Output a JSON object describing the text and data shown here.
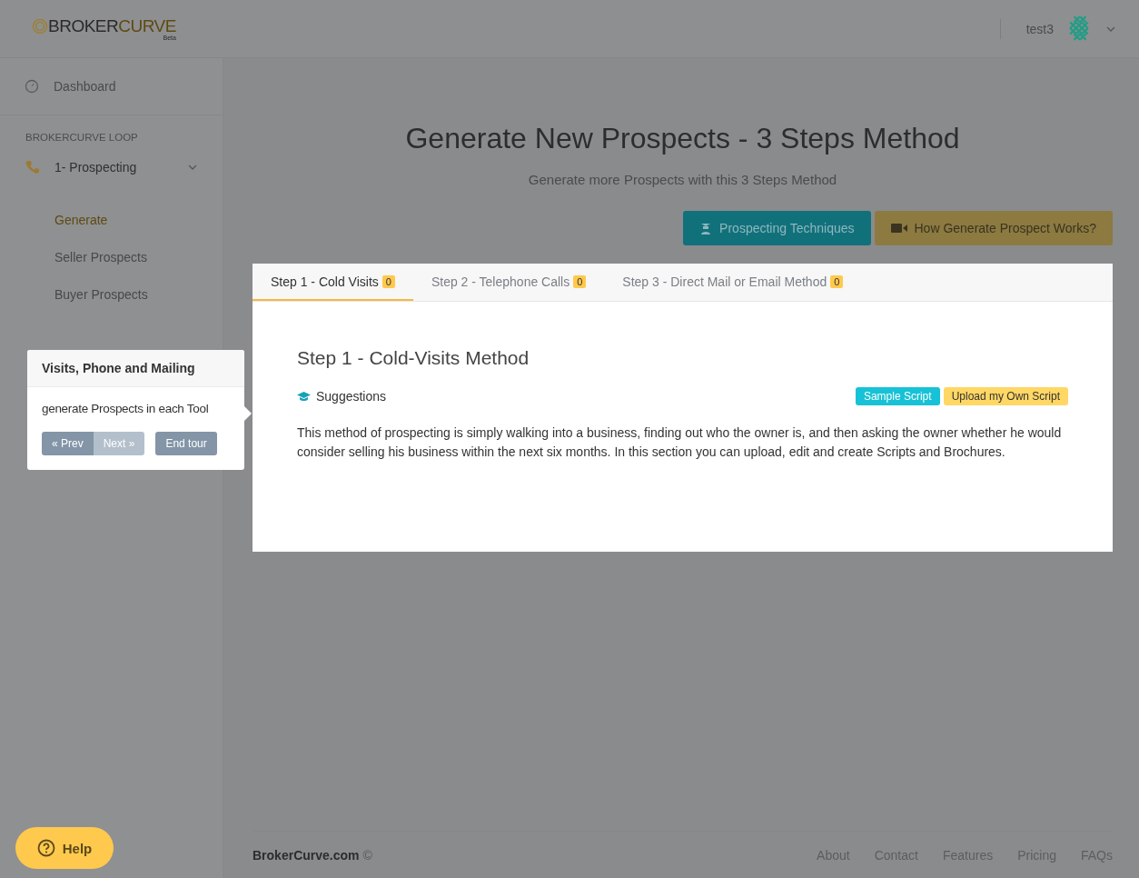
{
  "header": {
    "logo": {
      "word_1": "BROKER",
      "word_2": "CURVE",
      "tag": "Beta"
    },
    "user": {
      "name": "test3"
    }
  },
  "sidebar": {
    "top_item": {
      "label": "Dashboard"
    },
    "section": "BROKERCURVE LOOP",
    "groups": [
      {
        "label": "1- Prospecting",
        "expanded": true,
        "children": [
          {
            "label": "Generate",
            "selected": true
          },
          {
            "label": "Seller Prospects",
            "selected": false
          },
          {
            "label": "Buyer Prospects",
            "selected": false
          }
        ]
      }
    ]
  },
  "page": {
    "title": "Generate New Prospects - 3 Steps Method",
    "subtitle": "Generate more Prospects with this 3 Steps Method",
    "actions": [
      {
        "label": "Prospecting Techniques",
        "kind": "teal"
      },
      {
        "label": "How Generate Prospect Works?",
        "kind": "gold"
      }
    ],
    "tabs": [
      {
        "label": "Step 1 - Cold Visits",
        "count": "0",
        "selected": true
      },
      {
        "label": "Step 2 - Telephone Calls",
        "count": "0",
        "selected": false
      },
      {
        "label": "Step 3 - Direct Mail or Email Method",
        "count": "0",
        "selected": false
      }
    ],
    "panel": {
      "heading": "Step 1 - Cold-Visits Method",
      "suggestions": "Suggestions",
      "tags": [
        {
          "label": "Sample Script",
          "kind": "teal"
        },
        {
          "label": "Upload my Own Script",
          "kind": "gold"
        }
      ],
      "body": "This method of prospecting is simply walking into a business, finding out who the owner is, and then asking the owner whether he would consider selling his business within the next six months. In this section you can upload, edit and create Scripts and Brochures."
    }
  },
  "tour": {
    "title": "Visits, Phone and Mailing",
    "text": "generate Prospects in each Tool",
    "buttons": [
      {
        "label": "« Prev",
        "disabled": false
      },
      {
        "label": "Next »",
        "disabled": true
      }
    ],
    "end": "End tour"
  },
  "help": {
    "label": "Help"
  },
  "footer": {
    "brand": "BrokerCurve.com",
    "mark": "©",
    "links": [
      "About",
      "Contact",
      "Features",
      "Pricing",
      "FAQs"
    ]
  }
}
